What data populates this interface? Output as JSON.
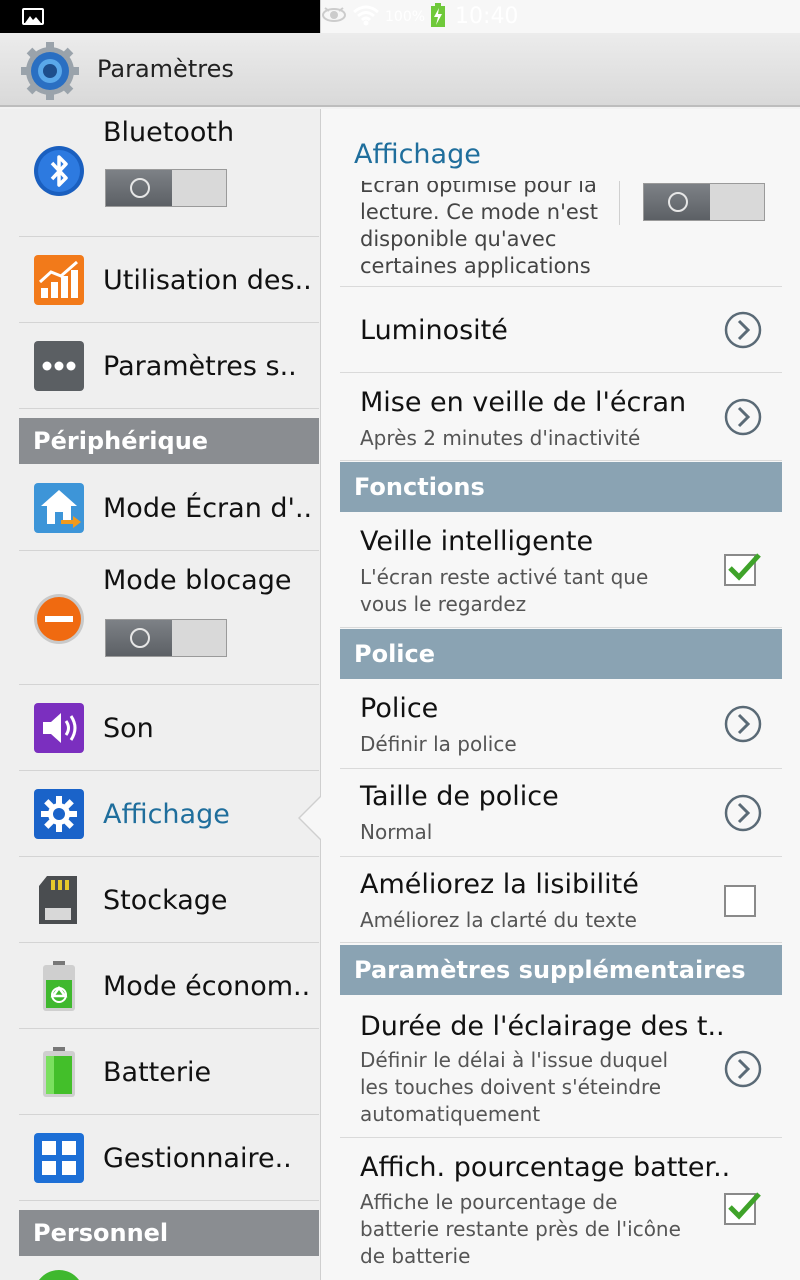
{
  "status_bar": {
    "battery_percent": "100%",
    "time": "10:40",
    "icons": [
      "image-notification-icon",
      "eye-icon",
      "wifi-icon",
      "battery-charging-icon"
    ]
  },
  "action_bar": {
    "title": "Paramètres",
    "icon": "settings-gear-icon"
  },
  "left_panel": {
    "items": [
      {
        "label": "Bluetooth",
        "icon": "bluetooth-icon",
        "toggle": "off"
      },
      {
        "label": "Utilisation des..",
        "icon": "data-usage-icon"
      },
      {
        "label": "Paramètres s..",
        "icon": "more-settings-icon"
      },
      {
        "label": "Mode Écran d'..",
        "icon": "home-screen-mode-icon"
      },
      {
        "label": "Mode blocage",
        "icon": "blocking-mode-icon",
        "toggle": "off"
      },
      {
        "label": "Son",
        "icon": "sound-icon"
      },
      {
        "label": "Affichage",
        "icon": "display-icon",
        "selected": true
      },
      {
        "label": "Stockage",
        "icon": "storage-icon"
      },
      {
        "label": "Mode économ..",
        "icon": "power-saving-icon"
      },
      {
        "label": "Batterie",
        "icon": "battery-icon"
      },
      {
        "label": "Gestionnaire..",
        "icon": "application-manager-icon"
      }
    ],
    "headers": {
      "device": "Périphérique",
      "personal": "Personnel"
    }
  },
  "right_panel": {
    "title": "Affichage",
    "partial_row": {
      "text_lines": [
        "Écran optimisé pour la",
        "lecture. Ce mode n'est",
        "disponible qu'avec",
        "certaines applications"
      ],
      "toggle": "off"
    },
    "rows": {
      "brightness": {
        "title": "Luminosité"
      },
      "sleep": {
        "title": "Mise en veille de l'écran",
        "subtitle": "Après 2 minutes d'inactivité"
      },
      "smart_stay": {
        "title": "Veille intelligente",
        "subtitle": "L'écran reste activé tant que vous le regardez",
        "checked": true
      },
      "font": {
        "title": "Police",
        "subtitle": "Définir la police"
      },
      "font_size": {
        "title": "Taille de police",
        "subtitle": "Normal"
      },
      "readability": {
        "title": "Améliorez la lisibilité",
        "subtitle": "Améliorez la clarté du texte",
        "checked": false
      },
      "key_light": {
        "title": "Durée de l'éclairage des t..",
        "subtitle": "Définir le délai à l'issue duquel les touches doivent s'éteindre automatiquement"
      },
      "battery_pct": {
        "title": "Affich. pourcentage batter..",
        "subtitle": "Affiche le pourcentage de batterie restante près de l'icône de batterie",
        "checked": true
      }
    },
    "sections": {
      "functions": "Fonctions",
      "font": "Police",
      "additional": "Paramètres supplémentaires"
    }
  },
  "colors": {
    "accent_blue": "#1f6e9c",
    "section_header": "#8aa3b3",
    "left_header": "#8a8d91",
    "check_green": "#3fa32a"
  }
}
